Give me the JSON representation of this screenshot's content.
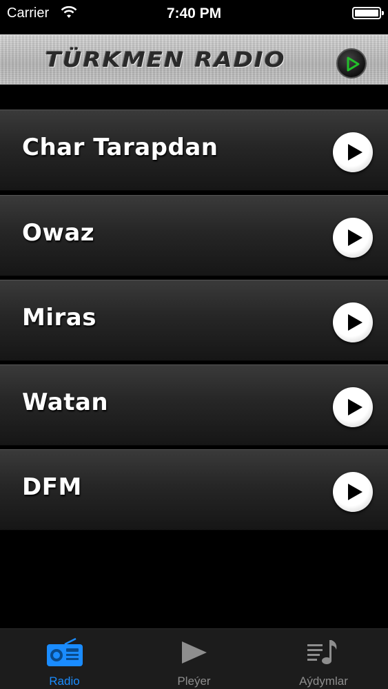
{
  "status_bar": {
    "carrier": "Carrier",
    "time": "7:40 PM",
    "wifi_icon": "wifi-icon",
    "battery_icon": "battery-icon"
  },
  "header": {
    "title": "TÜRKMEN RADIO",
    "play_icon": "play-icon",
    "accent_color": "#22c02a"
  },
  "stations": [
    {
      "name": "Char Tarapdan",
      "icon": "play-icon"
    },
    {
      "name": "Owaz",
      "icon": "play-icon"
    },
    {
      "name": "Miras",
      "icon": "play-icon"
    },
    {
      "name": "Watan",
      "icon": "play-icon"
    },
    {
      "name": "DFM",
      "icon": "play-icon"
    }
  ],
  "tabs": [
    {
      "label": "Radio",
      "icon": "radio-icon",
      "active": true
    },
    {
      "label": "Pleýer",
      "icon": "play-icon",
      "active": false
    },
    {
      "label": "Aýdymlar",
      "icon": "music-list-icon",
      "active": false
    }
  ],
  "colors": {
    "active_tab": "#1a8cff",
    "inactive_tab": "#8e8e8e",
    "background": "#000000"
  }
}
